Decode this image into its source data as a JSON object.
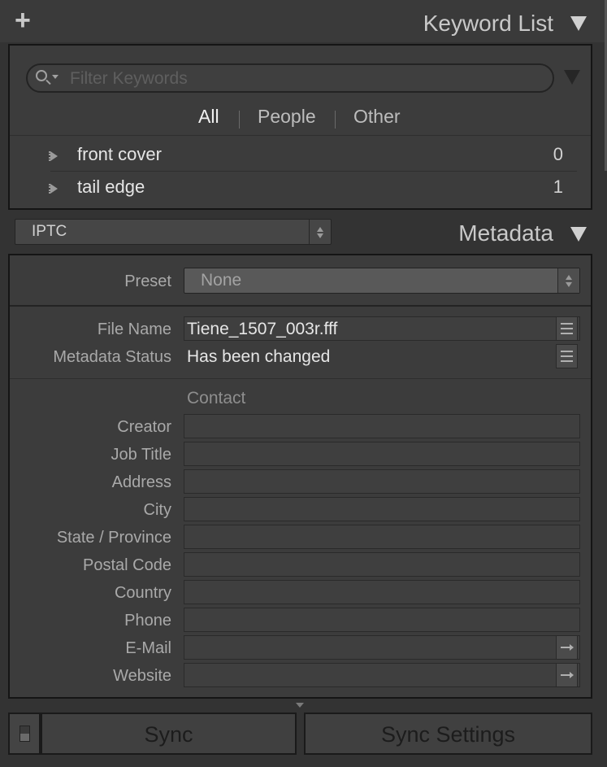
{
  "keyword_panel": {
    "add_label": "+",
    "title": "Keyword List",
    "filter_placeholder": "Filter Keywords",
    "tabs": [
      "All",
      "People",
      "Other"
    ],
    "active_tab": "All",
    "keywords": [
      {
        "name": "front cover",
        "count": "0"
      },
      {
        "name": "tail edge",
        "count": "1"
      }
    ]
  },
  "metadata_panel": {
    "view_select": "IPTC",
    "title": "Metadata",
    "preset_label": "Preset",
    "preset_value": "None",
    "file_name_label": "File Name",
    "file_name": "Tiene_1507_003r.fff",
    "status_label": "Metadata Status",
    "status": "Has been changed",
    "contact_heading": "Contact",
    "contact_fields": [
      "Creator",
      "Job Title",
      "Address",
      "City",
      "State / Province",
      "Postal Code",
      "Country",
      "Phone",
      "E-Mail",
      "Website"
    ]
  },
  "bottom_bar": {
    "sync_label": "Sync",
    "sync_settings_label": "Sync Settings"
  },
  "icons": [
    "plus-icon",
    "search-icon",
    "disclosure-triangle-icon",
    "list-icon",
    "arrow-right-icon",
    "stepper-icon"
  ]
}
